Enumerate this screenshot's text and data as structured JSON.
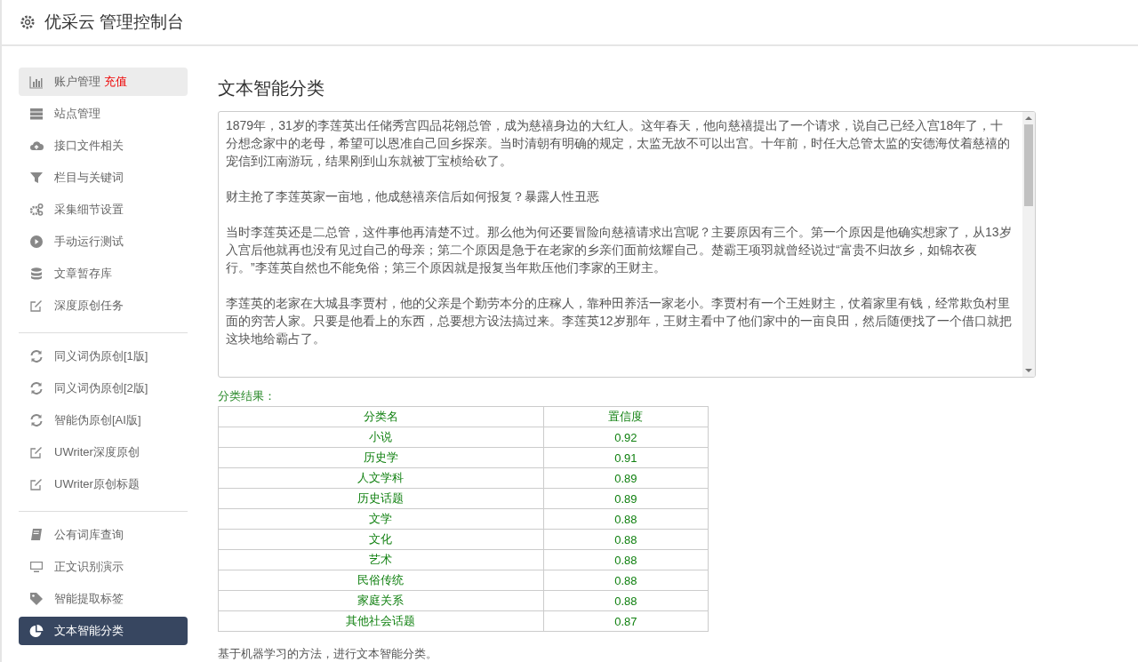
{
  "header": {
    "title": "优采云 管理控制台"
  },
  "sidebar": {
    "groups": [
      [
        {
          "label": "账户管理",
          "extra": "充值",
          "selected": false,
          "highlighted": true
        },
        {
          "label": "站点管理",
          "selected": false,
          "highlighted": false
        },
        {
          "label": "接口文件相关",
          "selected": false,
          "highlighted": false
        },
        {
          "label": "栏目与关键词",
          "selected": false,
          "highlighted": false
        },
        {
          "label": "采集细节设置",
          "selected": false,
          "highlighted": false
        },
        {
          "label": "手动运行测试",
          "selected": false,
          "highlighted": false
        },
        {
          "label": "文章暂存库",
          "selected": false,
          "highlighted": false
        },
        {
          "label": "深度原创任务",
          "selected": false,
          "highlighted": false
        }
      ],
      [
        {
          "label": "同义词伪原创[1版]",
          "selected": false,
          "highlighted": false
        },
        {
          "label": "同义词伪原创[2版]",
          "selected": false,
          "highlighted": false
        },
        {
          "label": "智能伪原创[AI版]",
          "selected": false,
          "highlighted": false
        },
        {
          "label": "UWriter深度原创",
          "selected": false,
          "highlighted": false
        },
        {
          "label": "UWriter原创标题",
          "selected": false,
          "highlighted": false
        }
      ],
      [
        {
          "label": "公有词库查询",
          "selected": false,
          "highlighted": false
        },
        {
          "label": "正文识别演示",
          "selected": false,
          "highlighted": false
        },
        {
          "label": "智能提取标签",
          "selected": false,
          "highlighted": false
        },
        {
          "label": "文本智能分类",
          "selected": true,
          "highlighted": false
        }
      ]
    ]
  },
  "main": {
    "title": "文本智能分类",
    "input_text": [
      "1879年，31岁的李莲英出任储秀宫四品花翎总管，成为慈禧身边的大红人。这年春天，他向慈禧提出了一个请求，说自己已经入宫18年了，十分想念家中的老母，希望可以恩准自己回乡探亲。当时清朝有明确的规定，太监无故不可以出宫。十年前，时任大总管太监的安德海仗着慈禧的宠信到江南游玩，结果刚到山东就被丁宝桢给砍了。",
      "财主抢了李莲英家一亩地，他成慈禧亲信后如何报复？暴露人性丑恶",
      "当时李莲英还是二总管，这件事他再清楚不过。那么他为何还要冒险向慈禧请求出宫呢？主要原因有三个。第一个原因是他确实想家了，从13岁入宫后他就再也没有见过自己的母亲；第二个原因是急于在老家的乡亲们面前炫耀自己。楚霸王项羽就曾经说过“富贵不归故乡，如锦衣夜行。”李莲英自然也不能免俗；第三个原因就是报复当年欺压他们李家的王财主。",
      "李莲英的老家在大城县李贾村，他的父亲是个勤劳本分的庄稼人，靠种田养活一家老小。李贾村有一个王姓财主，仗着家里有钱，经常欺负村里面的穷苦人家。只要是他看上的东西，总要想方设法搞过来。李莲英12岁那年，王财主看中了他们家中的一亩良田，然后随便找了一个借口就把这块地给霸占了。"
    ],
    "result_label": "分类结果：",
    "table": {
      "columns": [
        "分类名",
        "置信度"
      ],
      "rows": [
        [
          "小说",
          "0.92"
        ],
        [
          "历史学",
          "0.91"
        ],
        [
          "人文学科",
          "0.89"
        ],
        [
          "历史话题",
          "0.89"
        ],
        [
          "文学",
          "0.88"
        ],
        [
          "文化",
          "0.88"
        ],
        [
          "艺术",
          "0.88"
        ],
        [
          "民俗传统",
          "0.88"
        ],
        [
          "家庭关系",
          "0.88"
        ],
        [
          "其他社会话题",
          "0.87"
        ]
      ]
    },
    "description": "基于机器学习的方法，进行文本智能分类。"
  }
}
